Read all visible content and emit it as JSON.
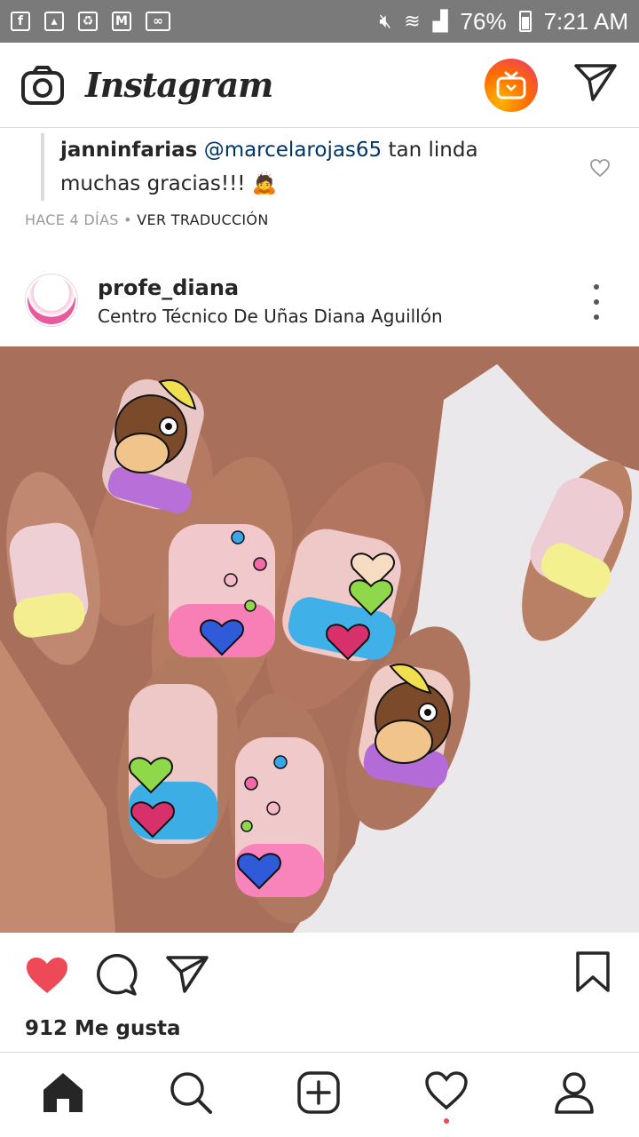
{
  "status_bar": {
    "battery": "76%",
    "time": "7:21 AM"
  },
  "header": {
    "app_name": "Instagram"
  },
  "comment": {
    "username": "janninfarias",
    "mention": "@marcelarojas65",
    "text_1": " tan linda",
    "text_2": "muchas gracias!!! 🙇",
    "time_ago": "HACE 4 DÍAS",
    "separator": " • ",
    "translate": "VER TRADUCCIÓN"
  },
  "post": {
    "username": "profe_diana",
    "subtitle": "Centro Técnico De Uñas Diana Aguillón",
    "likes": "912 Me gusta"
  },
  "colors": {
    "like_red": "#ed4956",
    "mention_blue": "#003569",
    "meta_gray": "#999999"
  }
}
